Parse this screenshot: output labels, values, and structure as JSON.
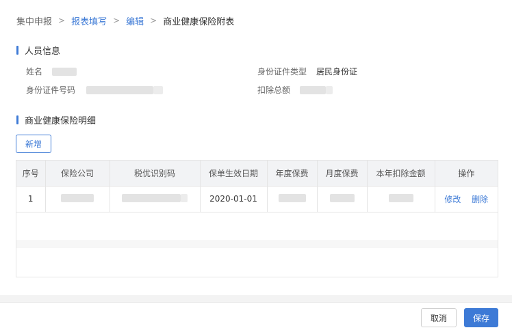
{
  "breadcrumb": {
    "items": [
      "集中申报",
      "报表填写",
      "编辑",
      "商业健康保险附表"
    ],
    "separator": ">"
  },
  "person_info": {
    "title": "人员信息",
    "name_label": "姓名",
    "id_type_label": "身份证件类型",
    "id_type_value": "居民身份证",
    "id_number_label": "身份证件号码",
    "deduction_total_label": "扣除总额"
  },
  "insurance_detail": {
    "title": "商业健康保险明细",
    "add_button": "新增",
    "columns": [
      "序号",
      "保险公司",
      "税优识别码",
      "保单生效日期",
      "年度保费",
      "月度保费",
      "本年扣除金额",
      "操作"
    ],
    "rows": [
      {
        "index": "1",
        "effective_date": "2020-01-01",
        "edit_label": "修改",
        "delete_label": "删除"
      }
    ]
  },
  "footer": {
    "cancel_label": "取消",
    "save_label": "保存"
  },
  "colors": {
    "accent": "#3d7ad6",
    "header_bg": "#f2f3f5",
    "border": "#e4e4e4"
  }
}
